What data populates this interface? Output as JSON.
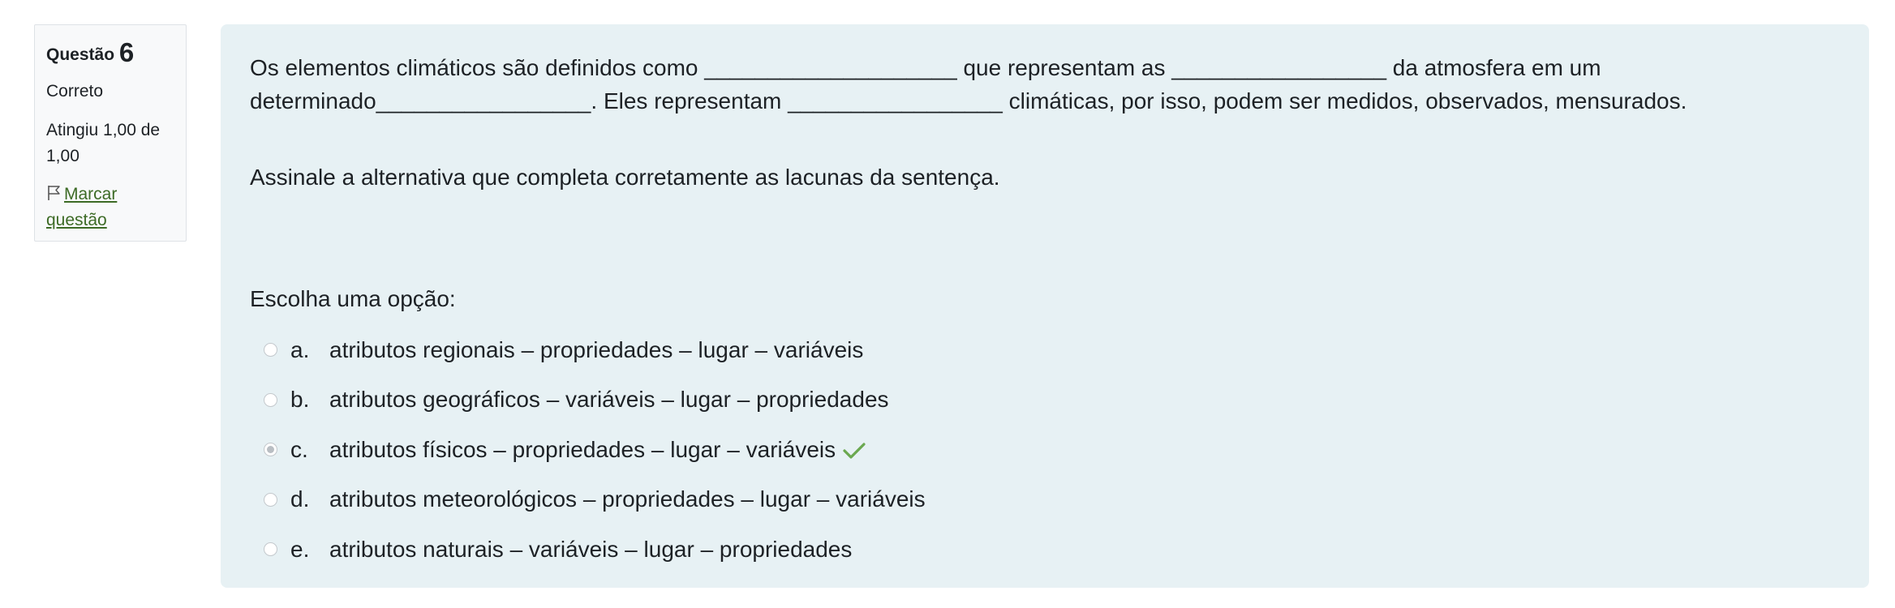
{
  "info": {
    "question_label": "Questão",
    "question_number": "6",
    "state": "Correto",
    "grade": "Atingiu 1,00 de 1,00",
    "flag_icon": "flag-icon",
    "flag_label": "Marcar questão"
  },
  "question": {
    "text_para1": "Os elementos climáticos são definidos como ____________________ que representam as _________________ da atmosfera em um determinado_________________. Eles representam _________________ climáticas, por isso, podem ser medidos, observados, mensurados.",
    "text_para2": "Assinale a alternativa que completa corretamente as lacunas da sentença.",
    "prompt": "Escolha uma opção:",
    "options": [
      {
        "letter": "a.",
        "text": "atributos regionais – propriedades – lugar – variáveis",
        "selected": false
      },
      {
        "letter": "b.",
        "text": "atributos geográficos – variáveis – lugar – propriedades",
        "selected": false
      },
      {
        "letter": "c.",
        "text": "atributos físicos – propriedades – lugar – variáveis",
        "selected": true,
        "feedback_icon": "check-icon"
      },
      {
        "letter": "d.",
        "text": "atributos meteorológicos – propriedades – lugar – variáveis",
        "selected": false
      },
      {
        "letter": "e.",
        "text": "atributos naturais – variáveis – lugar – propriedades",
        "selected": false
      }
    ]
  },
  "colors": {
    "info_background": "#f8f9fa",
    "content_background": "#e7f1f4",
    "link": "#3d6b26",
    "correct_check": "#6aa84f"
  }
}
